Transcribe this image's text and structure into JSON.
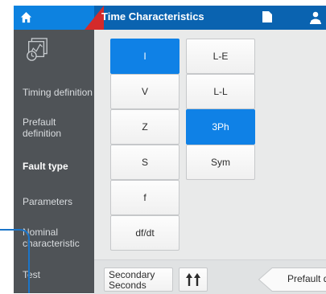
{
  "header": {
    "title": "Time Characteristics",
    "icons": [
      "home-icon",
      "file-icon",
      "person-icon"
    ]
  },
  "sidebar": {
    "logo_icon": "timing-diagram-icon",
    "items": [
      {
        "label": "Timing definition",
        "active": false
      },
      {
        "label": "Prefault definition",
        "active": false
      },
      {
        "label": "Fault type",
        "active": true
      },
      {
        "label": "Parameters",
        "active": false
      },
      {
        "label": "Nominal characteristic",
        "active": false
      },
      {
        "label": "Test",
        "active": false
      }
    ]
  },
  "quantity_buttons": [
    {
      "label": "I",
      "selected": true
    },
    {
      "label": "V",
      "selected": false
    },
    {
      "label": "Z",
      "selected": false
    },
    {
      "label": "S",
      "selected": false
    },
    {
      "label": "f",
      "selected": false
    },
    {
      "label": "df/dt",
      "selected": false
    }
  ],
  "fault_buttons": [
    {
      "label": "L-E",
      "selected": false
    },
    {
      "label": "L-L",
      "selected": false
    },
    {
      "label": "3Ph",
      "selected": true
    },
    {
      "label": "Sym",
      "selected": false
    }
  ],
  "bottom": {
    "secondary_line1": "Secondary",
    "secondary_line2": "Seconds",
    "updown_icon": "up-arrows-icon",
    "prefault_label": "Prefault d"
  },
  "colors": {
    "accent": "#0f81e6",
    "topbar": "#0a63b0",
    "sidebar": "#4f5357",
    "red_accent": "#d42a2a"
  }
}
